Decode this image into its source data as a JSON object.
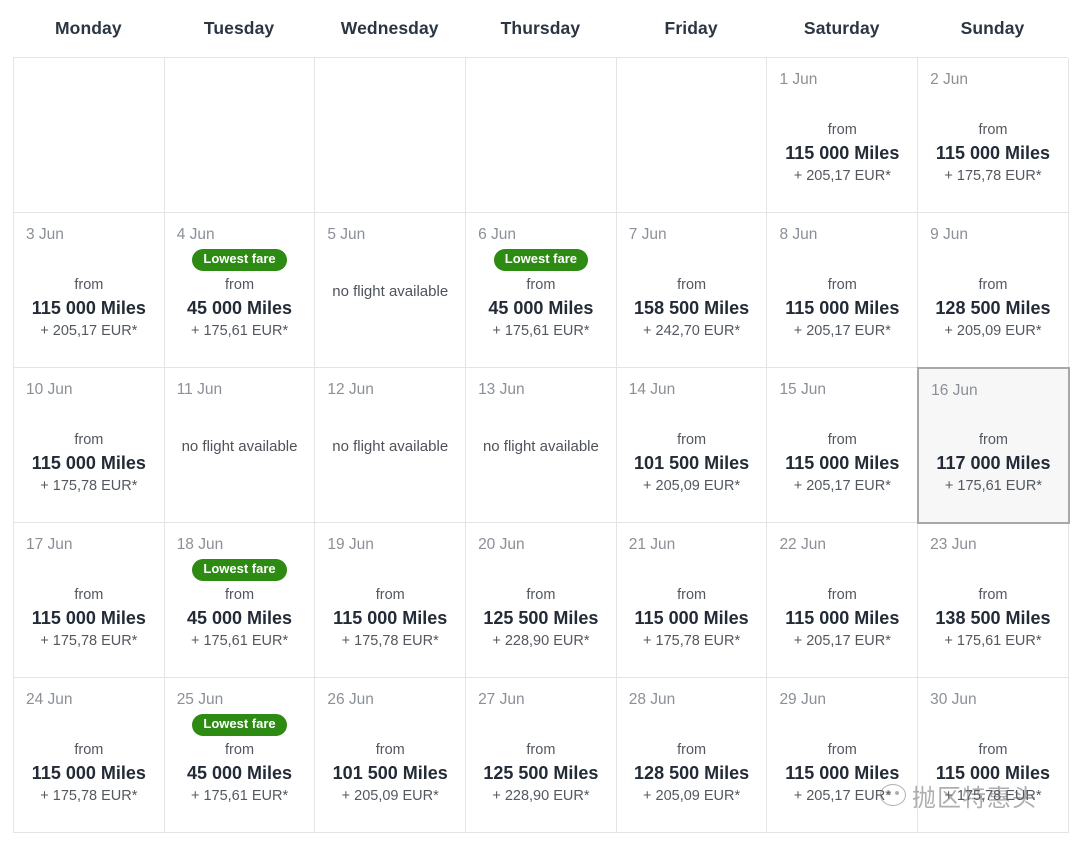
{
  "header": {
    "days": [
      "Monday",
      "Tuesday",
      "Wednesday",
      "Thursday",
      "Friday",
      "Saturday",
      "Sunday"
    ]
  },
  "labels": {
    "from": "from",
    "no_flight": "no flight available",
    "lowest_fare": "Lowest fare"
  },
  "colors": {
    "badge_green": "#2d8a12",
    "grid_line": "#e2e4e7",
    "date_gray": "#8b9097",
    "miles_dark": "#232b36",
    "selected_border": "#a8a8ab",
    "selected_bg": "#f7f7f8"
  },
  "watermark": {
    "text": "抛区特惠头",
    "icon": "wechat-face-icon"
  },
  "cells": [
    {
      "empty": true
    },
    {
      "empty": true
    },
    {
      "empty": true
    },
    {
      "empty": true
    },
    {
      "empty": true
    },
    {
      "date": "1 Jun",
      "from": "from",
      "miles": "115 000 Miles",
      "cash": "+ 205,17 EUR*"
    },
    {
      "date": "2 Jun",
      "from": "from",
      "miles": "115 000 Miles",
      "cash": "+ 175,78 EUR*"
    },
    {
      "date": "3 Jun",
      "from": "from",
      "miles": "115 000 Miles",
      "cash": "+ 205,17 EUR*"
    },
    {
      "date": "4 Jun",
      "badge": "Lowest fare",
      "from": "from",
      "miles": "45 000 Miles",
      "cash": "+ 175,61 EUR*"
    },
    {
      "date": "5 Jun",
      "no_flight": "no flight available"
    },
    {
      "date": "6 Jun",
      "badge": "Lowest fare",
      "from": "from",
      "miles": "45 000 Miles",
      "cash": "+ 175,61 EUR*"
    },
    {
      "date": "7 Jun",
      "from": "from",
      "miles": "158 500 Miles",
      "cash": "+ 242,70 EUR*"
    },
    {
      "date": "8 Jun",
      "from": "from",
      "miles": "115 000 Miles",
      "cash": "+ 205,17 EUR*"
    },
    {
      "date": "9 Jun",
      "from": "from",
      "miles": "128 500 Miles",
      "cash": "+ 205,09 EUR*"
    },
    {
      "date": "10 Jun",
      "from": "from",
      "miles": "115 000 Miles",
      "cash": "+ 175,78 EUR*"
    },
    {
      "date": "11 Jun",
      "no_flight": "no flight available"
    },
    {
      "date": "12 Jun",
      "no_flight": "no flight available"
    },
    {
      "date": "13 Jun",
      "no_flight": "no flight available"
    },
    {
      "date": "14 Jun",
      "from": "from",
      "miles": "101 500 Miles",
      "cash": "+ 205,09 EUR*"
    },
    {
      "date": "15 Jun",
      "from": "from",
      "miles": "115 000 Miles",
      "cash": "+ 205,17 EUR*"
    },
    {
      "date": "16 Jun",
      "from": "from",
      "miles": "117 000 Miles",
      "cash": "+ 175,61 EUR*",
      "selected": true
    },
    {
      "date": "17 Jun",
      "from": "from",
      "miles": "115 000 Miles",
      "cash": "+ 175,78 EUR*"
    },
    {
      "date": "18 Jun",
      "badge": "Lowest fare",
      "from": "from",
      "miles": "45 000 Miles",
      "cash": "+ 175,61 EUR*"
    },
    {
      "date": "19 Jun",
      "from": "from",
      "miles": "115 000 Miles",
      "cash": "+ 175,78 EUR*"
    },
    {
      "date": "20 Jun",
      "from": "from",
      "miles": "125 500 Miles",
      "cash": "+ 228,90 EUR*"
    },
    {
      "date": "21 Jun",
      "from": "from",
      "miles": "115 000 Miles",
      "cash": "+ 175,78 EUR*"
    },
    {
      "date": "22 Jun",
      "from": "from",
      "miles": "115 000 Miles",
      "cash": "+ 205,17 EUR*"
    },
    {
      "date": "23 Jun",
      "from": "from",
      "miles": "138 500 Miles",
      "cash": "+ 175,61 EUR*"
    },
    {
      "date": "24 Jun",
      "from": "from",
      "miles": "115 000 Miles",
      "cash": "+ 175,78 EUR*"
    },
    {
      "date": "25 Jun",
      "badge": "Lowest fare",
      "from": "from",
      "miles": "45 000 Miles",
      "cash": "+ 175,61 EUR*"
    },
    {
      "date": "26 Jun",
      "from": "from",
      "miles": "101 500 Miles",
      "cash": "+ 205,09 EUR*"
    },
    {
      "date": "27 Jun",
      "from": "from",
      "miles": "125 500 Miles",
      "cash": "+ 228,90 EUR*"
    },
    {
      "date": "28 Jun",
      "from": "from",
      "miles": "128 500 Miles",
      "cash": "+ 205,09 EUR*"
    },
    {
      "date": "29 Jun",
      "from": "from",
      "miles": "115 000 Miles",
      "cash": "+ 205,17 EUR*"
    },
    {
      "date": "30 Jun",
      "from": "from",
      "miles": "115 000 Miles",
      "cash": "+ 175,78 EUR*"
    }
  ]
}
